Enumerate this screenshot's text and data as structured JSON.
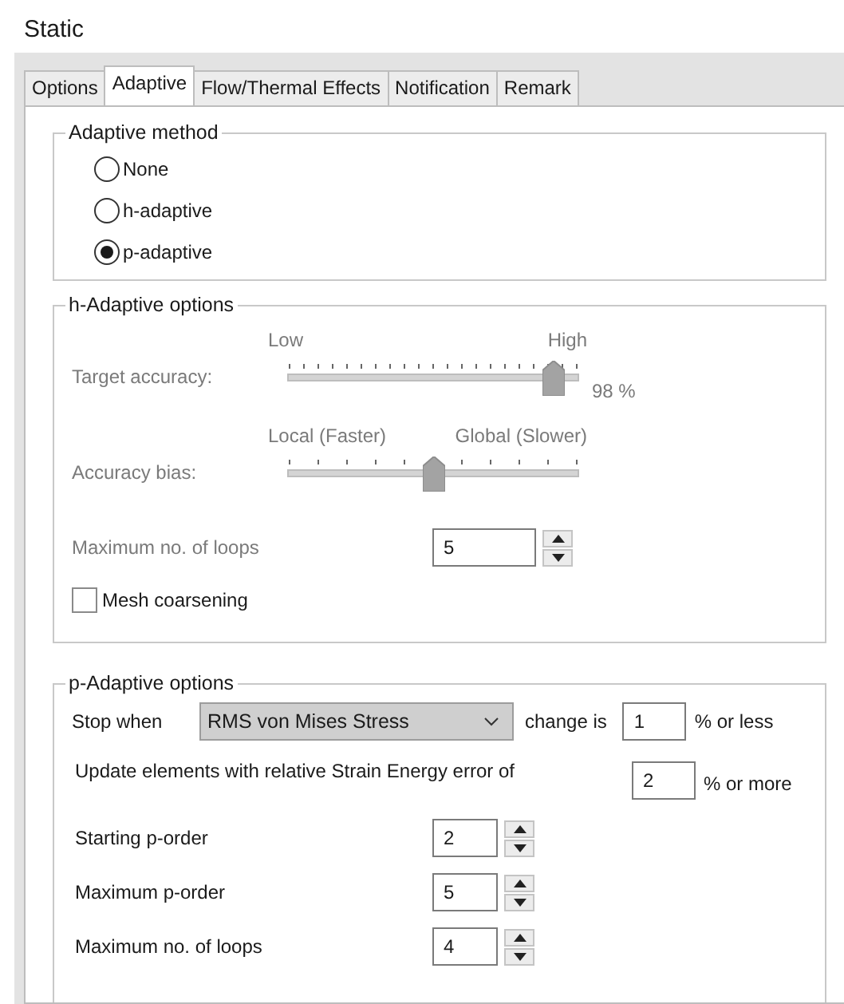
{
  "title": "Static",
  "tabs": [
    {
      "label": "Options",
      "selected": false
    },
    {
      "label": "Adaptive",
      "selected": true
    },
    {
      "label": "Flow/Thermal Effects",
      "selected": false
    },
    {
      "label": "Notification",
      "selected": false
    },
    {
      "label": "Remark",
      "selected": false
    }
  ],
  "adaptive_method": {
    "legend": "Adaptive method",
    "options": [
      {
        "label": "None",
        "selected": false
      },
      {
        "label": "h-adaptive",
        "selected": false
      },
      {
        "label": "p-adaptive",
        "selected": true
      }
    ]
  },
  "h_adaptive": {
    "legend": "h-Adaptive options",
    "disabled": true,
    "target_accuracy": {
      "label": "Target accuracy:",
      "low": "Low",
      "high": "High",
      "level": 0.91,
      "reading": "98 %"
    },
    "accuracy_bias": {
      "label": "Accuracy bias:",
      "low": "Local (Faster)",
      "high": "Global (Slower)",
      "level": 0.5
    },
    "max_loops": {
      "label": "Maximum no. of loops",
      "value": "5"
    },
    "mesh_coarsening": {
      "label": "Mesh coarsening",
      "checked": false
    }
  },
  "p_adaptive": {
    "legend": "p-Adaptive options",
    "stop_when": {
      "label": "Stop when",
      "value": "RMS von Mises Stress",
      "after": "change is",
      "amount": "1",
      "unit": "% or less"
    },
    "update": {
      "label": "Update elements with relative Strain Energy error of",
      "value": "2",
      "unit": "% or more"
    },
    "spinners": [
      {
        "label": "Starting p-order",
        "value": "2"
      },
      {
        "label": "Maximum p-order",
        "value": "5"
      },
      {
        "label": "Maximum no. of loops",
        "value": "4"
      }
    ]
  }
}
